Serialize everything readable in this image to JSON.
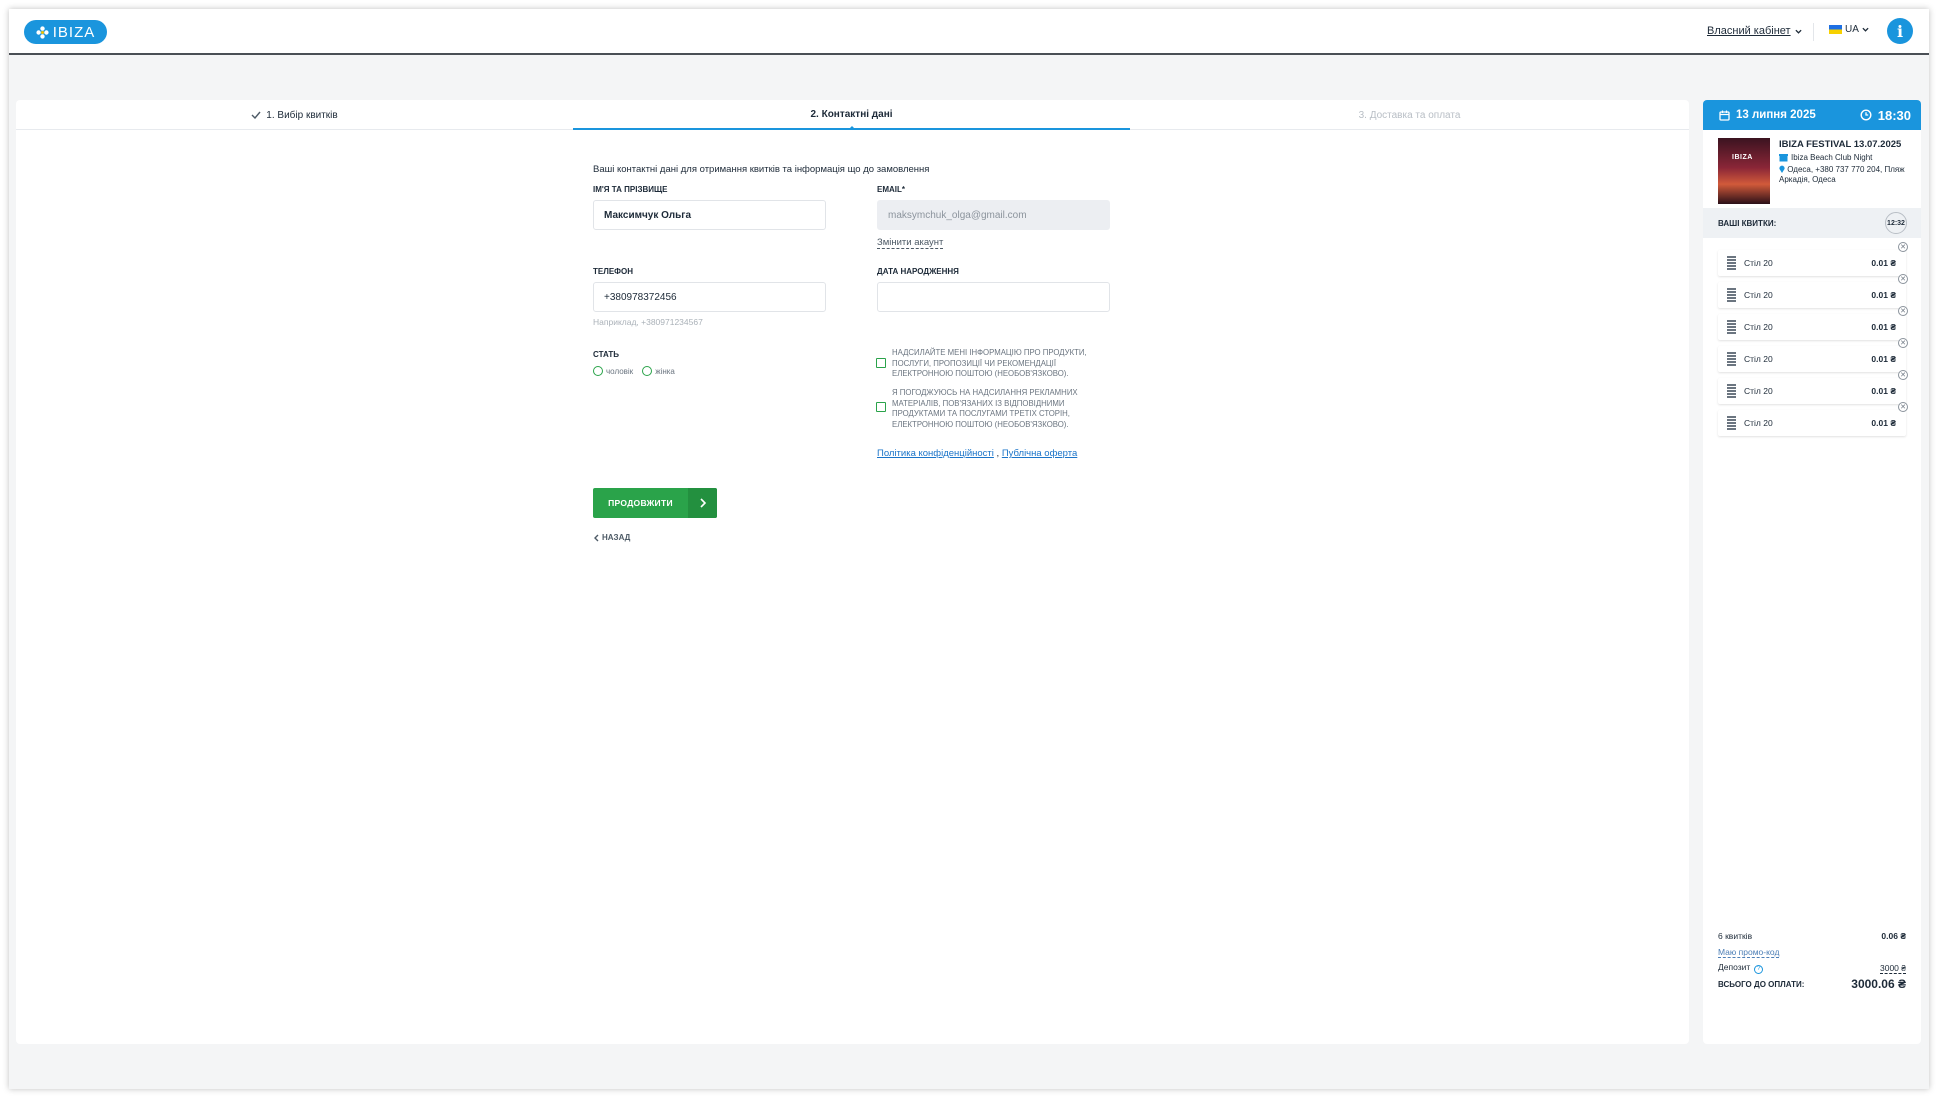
{
  "header": {
    "logo_text": "IBIZA",
    "cabinet_label": "Власний кабінет",
    "lang_label": "UA",
    "info_label": "i"
  },
  "steps": [
    {
      "label": "1. Вибір квитків",
      "state": "done"
    },
    {
      "label": "2. Контактні дані",
      "state": "active"
    },
    {
      "label": "3. Доставка та оплата",
      "state": "upcoming"
    }
  ],
  "form": {
    "intro": "Ваші контактні дані для отримання квитків та інформація що до замовлення",
    "name_label": "Ім'я та прізвище",
    "name_value": "Максимчук Ольга",
    "email_label": "EMAIL*",
    "email_value": "maksymchuk_olga@gmail.com",
    "change_account": "Змінити акаунт",
    "phone_label": "Телефон",
    "phone_value": "+380978372456",
    "phone_hint": "Наприклад, +380971234567",
    "birth_label": "Дата народження",
    "birth_value": "",
    "gender_label": "Стать",
    "gender_male": "чоловік",
    "gender_female": "жінка",
    "consent_1": "Надсилайте мені інформацію про продукти, послуги, пропозиції чи рекомендації електронною поштою (необов'язково).",
    "consent_2": "Я погоджуюсь на надсилання рекламних матеріалів, пов'язаних із відповідними продуктами та послугами третіх сторін, електронною поштою (необов'язково).",
    "privacy_link": "Політика конфіденційності",
    "link_sep": " , ",
    "offer_link": "Публічна оферта",
    "continue_label": "Продовжити",
    "back_label": "Назад"
  },
  "sidebar": {
    "date": "13 липня 2025",
    "time": "18:30",
    "poster_text": "IBIZA",
    "event_title": "IBIZA FESTIVAL 13.07.2025",
    "venue": "Ibiza Beach Club Night",
    "address": "Одеса, +380 737 770 204, Пляж Аркадія, Одеса",
    "tickets_label": "Ваші квитки:",
    "timer": "12:32",
    "tickets": [
      {
        "name": "Стіл 20",
        "price": "0.01 ₴"
      },
      {
        "name": "Стіл 20",
        "price": "0.01 ₴"
      },
      {
        "name": "Стіл 20",
        "price": "0.01 ₴"
      },
      {
        "name": "Стіл 20",
        "price": "0.01 ₴"
      },
      {
        "name": "Стіл 20",
        "price": "0.01 ₴"
      },
      {
        "name": "Стіл 20",
        "price": "0.01 ₴"
      }
    ],
    "count_label": "6 квитків",
    "count_value": "0.06 ₴",
    "promo_label": "Маю промо-код",
    "deposit_label": "Депозит",
    "deposit_value": "3000 ₴",
    "total_label": "Всього до оплати:",
    "total_value": "3000.06 ₴"
  },
  "colors": {
    "accent": "#1a95dd",
    "success": "#2aa34a",
    "text": "#1d2a38"
  }
}
